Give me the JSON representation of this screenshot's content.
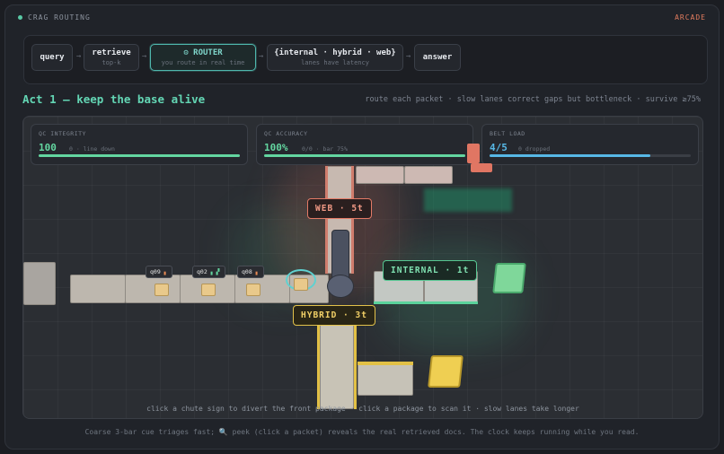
{
  "header": {
    "brand": "CRAG ROUTING",
    "mode": "ARCADE"
  },
  "pipeline": {
    "stages": [
      {
        "title": "query",
        "sub": ""
      },
      {
        "title": "retrieve",
        "sub": "top-k"
      },
      {
        "title": "⚙ ROUTER",
        "sub": "you route in real time"
      },
      {
        "title": "{internal · hybrid · web}",
        "sub": "lanes have latency"
      },
      {
        "title": "answer",
        "sub": ""
      }
    ],
    "arrow": "→"
  },
  "act": {
    "title": "Act 1 — keep the base alive",
    "rules": "route each packet · slow lanes correct gaps but bottleneck · survive ≥75%"
  },
  "meters": {
    "integrity": {
      "label": "QC INTEGRITY",
      "value": "100",
      "note": "0 · line down",
      "level": 1.0,
      "color": "#63d6a0"
    },
    "accuracy": {
      "label": "QC ACCURACY",
      "value": "100%",
      "note": "0/0 · bar 75%",
      "level": 1.0,
      "color": "#63d6a0"
    },
    "belt": {
      "label": "BELT LOAD",
      "value": "4/5",
      "note": "0 dropped",
      "level": 0.8,
      "color": "#57b8e6"
    }
  },
  "lanes": {
    "web": "WEB · 5t",
    "internal": "INTERNAL · 1t",
    "hybrid": "HYBRID · 3t"
  },
  "packets": [
    {
      "id": "q09",
      "signal": "▖"
    },
    {
      "id": "q02",
      "signal": "▖▗▘"
    },
    {
      "id": "q08",
      "signal": "▖"
    }
  ],
  "hint": "click a chute sign to divert the front package · click a package to scan it · slow lanes take longer",
  "footer": "Coarse 3-bar cue triages fast; 🔍 peek (click a packet) reveals the real retrieved docs. The clock keeps running while you read."
}
